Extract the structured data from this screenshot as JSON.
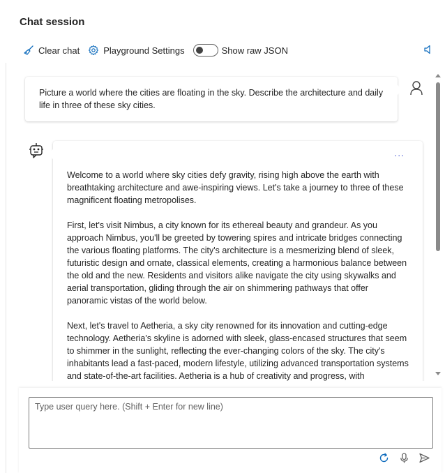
{
  "header": {
    "title": "Chat session"
  },
  "toolbar": {
    "clear_label": "Clear chat",
    "settings_label": "Playground Settings",
    "raw_json_label": "Show raw JSON",
    "raw_json_on": false
  },
  "messages": {
    "user_text": "Picture a world where the cities are floating in the sky. Describe the architecture and daily life in three of these sky cities.",
    "bot_more": "...",
    "bot_paragraphs": [
      "Welcome to a world where sky cities defy gravity, rising high above the earth with breathtaking architecture and awe-inspiring views. Let's take a journey to three of these magnificent floating metropolises.",
      "First, let's visit Nimbus, a city known for its ethereal beauty and grandeur. As you approach Nimbus, you'll be greeted by towering spires and intricate bridges connecting the various floating platforms. The city's architecture is a mesmerizing blend of sleek, futuristic design and ornate, classical elements, creating a harmonious balance between the old and the new. Residents and visitors alike navigate the city using skywalks and aerial transportation, gliding through the air on shimmering pathways that offer panoramic vistas of the world below.",
      "Next, let's travel to Aetheria, a sky city renowned for its innovation and cutting-edge technology. Aetheria's skyline is adorned with sleek, glass-encased structures that seem to shimmer in the sunlight, reflecting the ever-changing colors of the sky. The city's inhabitants lead a fast-paced, modern lifestyle, utilizing advanced transportation systems and state-of-the-art facilities. Aetheria is a hub of creativity and progress, with"
    ]
  },
  "input": {
    "placeholder": "Type user query here. (Shift + Enter for new line)"
  },
  "icons": {
    "clear": "broom-icon",
    "settings": "gear-icon",
    "speaker": "speaker-icon",
    "user": "person-icon",
    "bot": "bot-icon",
    "refresh": "refresh-icon",
    "mic": "microphone-icon",
    "send": "send-icon"
  },
  "colors": {
    "accent": "#0f6cbd",
    "more": "#5b6bd6"
  }
}
